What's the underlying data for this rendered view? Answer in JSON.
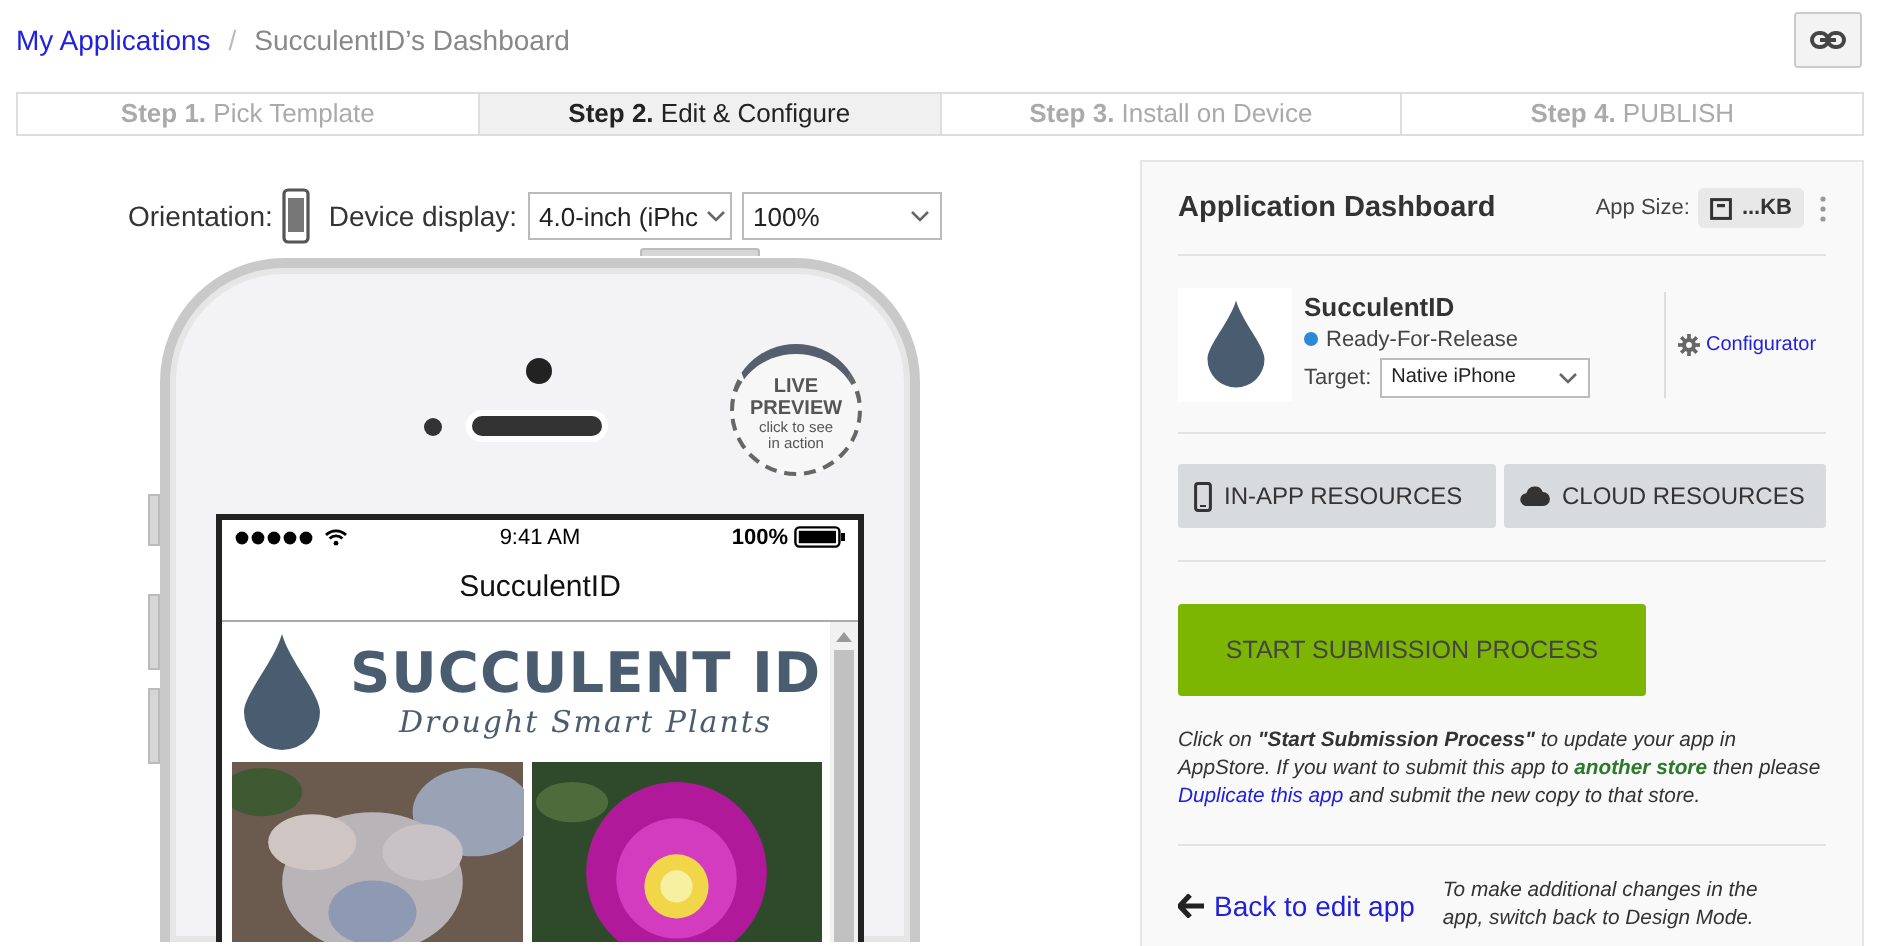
{
  "breadcrumb": [
    {
      "label": "My Applications",
      "kind": "link"
    },
    {
      "label": "SucculentID’s Dashboard",
      "kind": "current",
      "separator": "/"
    }
  ],
  "steps": [
    {
      "label": "**Step 1.** Pick Template",
      "selected": false
    },
    {
      "label": "**Step 2.** Edit & Configure",
      "selected": true
    },
    {
      "label": "**Step 3.** Install on Device",
      "selected": false
    },
    {
      "label": "**Step 4.** PUBLISH",
      "selected": false
    }
  ],
  "preview_controls": {
    "orientation_label": "Orientation:",
    "device_label": "Device display:",
    "device": "4.0-inch (iPhc",
    "zoom": "100%"
  },
  "phone": {
    "badge": [
      "LIVE",
      "PREVIEW",
      "click to see",
      "in action"
    ],
    "status_time": "9:41 AM",
    "battery": "100%",
    "title": "SucculentID",
    "logo_title": "SUCCULENT ID",
    "logo_tagline": "Drought Smart Plants"
  },
  "dashboard": {
    "title": "Application Dashboard",
    "app_size_label": "App Size:",
    "app_size": "...KB",
    "app": {
      "name": "SucculentID",
      "status": "Ready-For-Release",
      "target_label": "Target:",
      "target": "Native iPhone"
    },
    "configurator": "Configurator",
    "resources": [
      {
        "label": "IN-APP RESOURCES",
        "kind": "device"
      },
      {
        "label": "CLOUD RESOURCES",
        "kind": "cloud"
      }
    ],
    "submit": "START SUBMISSION PROCESS",
    "note": [
      {
        "kind": "text",
        "text": "Click on **\"Start Submission Process\"** to update your app in AppStore. If you want to submit this app to "
      },
      {
        "kind": "accent",
        "text": "another store"
      },
      {
        "kind": "text",
        "text": " then please "
      },
      {
        "kind": "link",
        "text": "Duplicate this app"
      },
      {
        "kind": "text",
        "text": " and submit the new copy to that store."
      }
    ],
    "back": "Back to edit app",
    "back_note": "To make additional changes in the app, switch back to Design Mode."
  }
}
